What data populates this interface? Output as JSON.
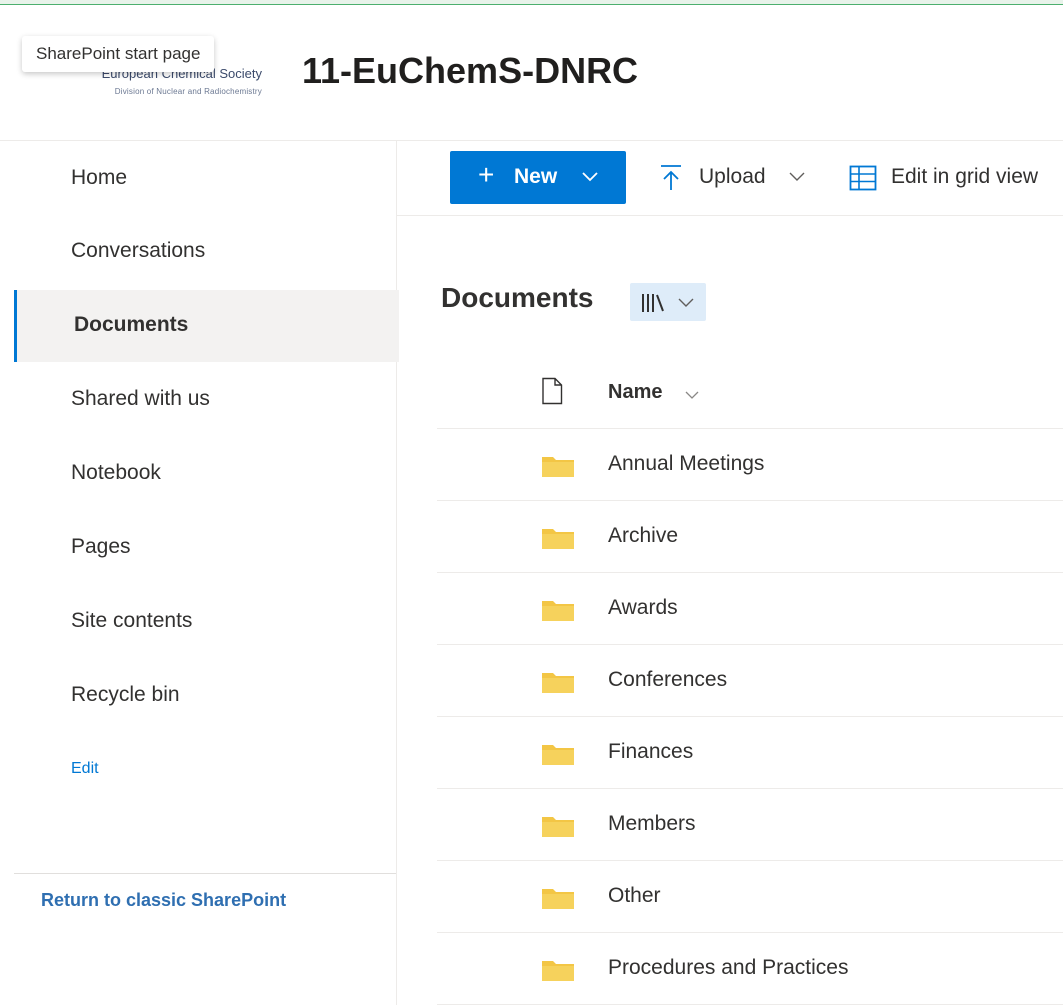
{
  "header": {
    "tooltip": "SharePoint start page",
    "logo_title": "European Chemical Society",
    "logo_subtitle": "Division of Nuclear and Radiochemistry",
    "site_title": "11-EuChemS-DNRC"
  },
  "nav": {
    "items": [
      {
        "label": "Home"
      },
      {
        "label": "Conversations"
      },
      {
        "label": "Documents"
      },
      {
        "label": "Shared with us"
      },
      {
        "label": "Notebook"
      },
      {
        "label": "Pages"
      },
      {
        "label": "Site contents"
      },
      {
        "label": "Recycle bin"
      }
    ],
    "active": "Documents",
    "edit_label": "Edit",
    "classic_label": "Return to classic SharePoint"
  },
  "commandbar": {
    "new_label": "New",
    "upload_label": "Upload",
    "grid_label": "Edit in grid view"
  },
  "library": {
    "title": "Documents",
    "columns": {
      "name": "Name"
    },
    "folders": [
      "Annual Meetings",
      "Archive",
      "Awards",
      "Conferences",
      "Finances",
      "Members",
      "Other",
      "Procedures and Practices"
    ]
  },
  "colors": {
    "accent": "#0078d4",
    "folder": "#f3c645",
    "active_nav_bg": "#f3f2f1",
    "view_switch_bg": "#deecf9"
  }
}
